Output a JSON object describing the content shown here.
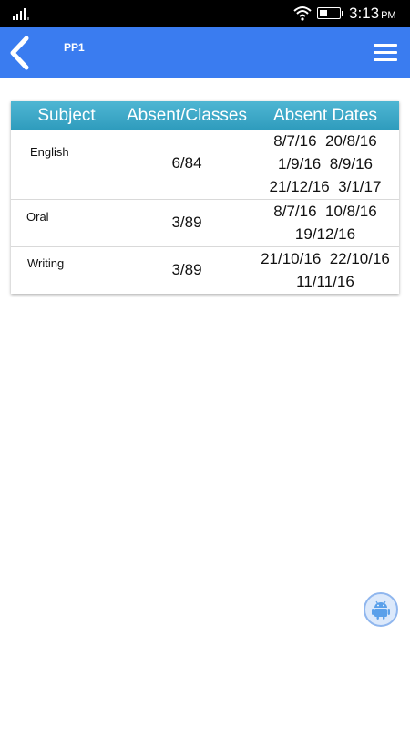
{
  "status_bar": {
    "time": "3:13",
    "ampm": "PM"
  },
  "app_bar": {
    "title": "PP1"
  },
  "table": {
    "headers": [
      "Subject",
      "Absent/Classes",
      "Absent Dates"
    ],
    "rows": [
      {
        "subject": "English",
        "absent": "6/84",
        "dates": [
          "8/7/16  20/8/16",
          "1/9/16  8/9/16",
          "21/12/16  3/1/17"
        ]
      },
      {
        "subject": "Oral",
        "absent": "3/89",
        "dates": [
          "8/7/16  10/8/16",
          "19/12/16"
        ]
      },
      {
        "subject": "Writing",
        "absent": "3/89",
        "dates": [
          "21/10/16  22/10/16",
          "11/11/16"
        ]
      }
    ]
  },
  "icons": {
    "back": "chevron-left-icon",
    "menu": "hamburger-menu-icon",
    "fab": "android-icon"
  },
  "colors": {
    "app_bar": "#3a7cf0",
    "table_header": "#3aa8c8"
  }
}
